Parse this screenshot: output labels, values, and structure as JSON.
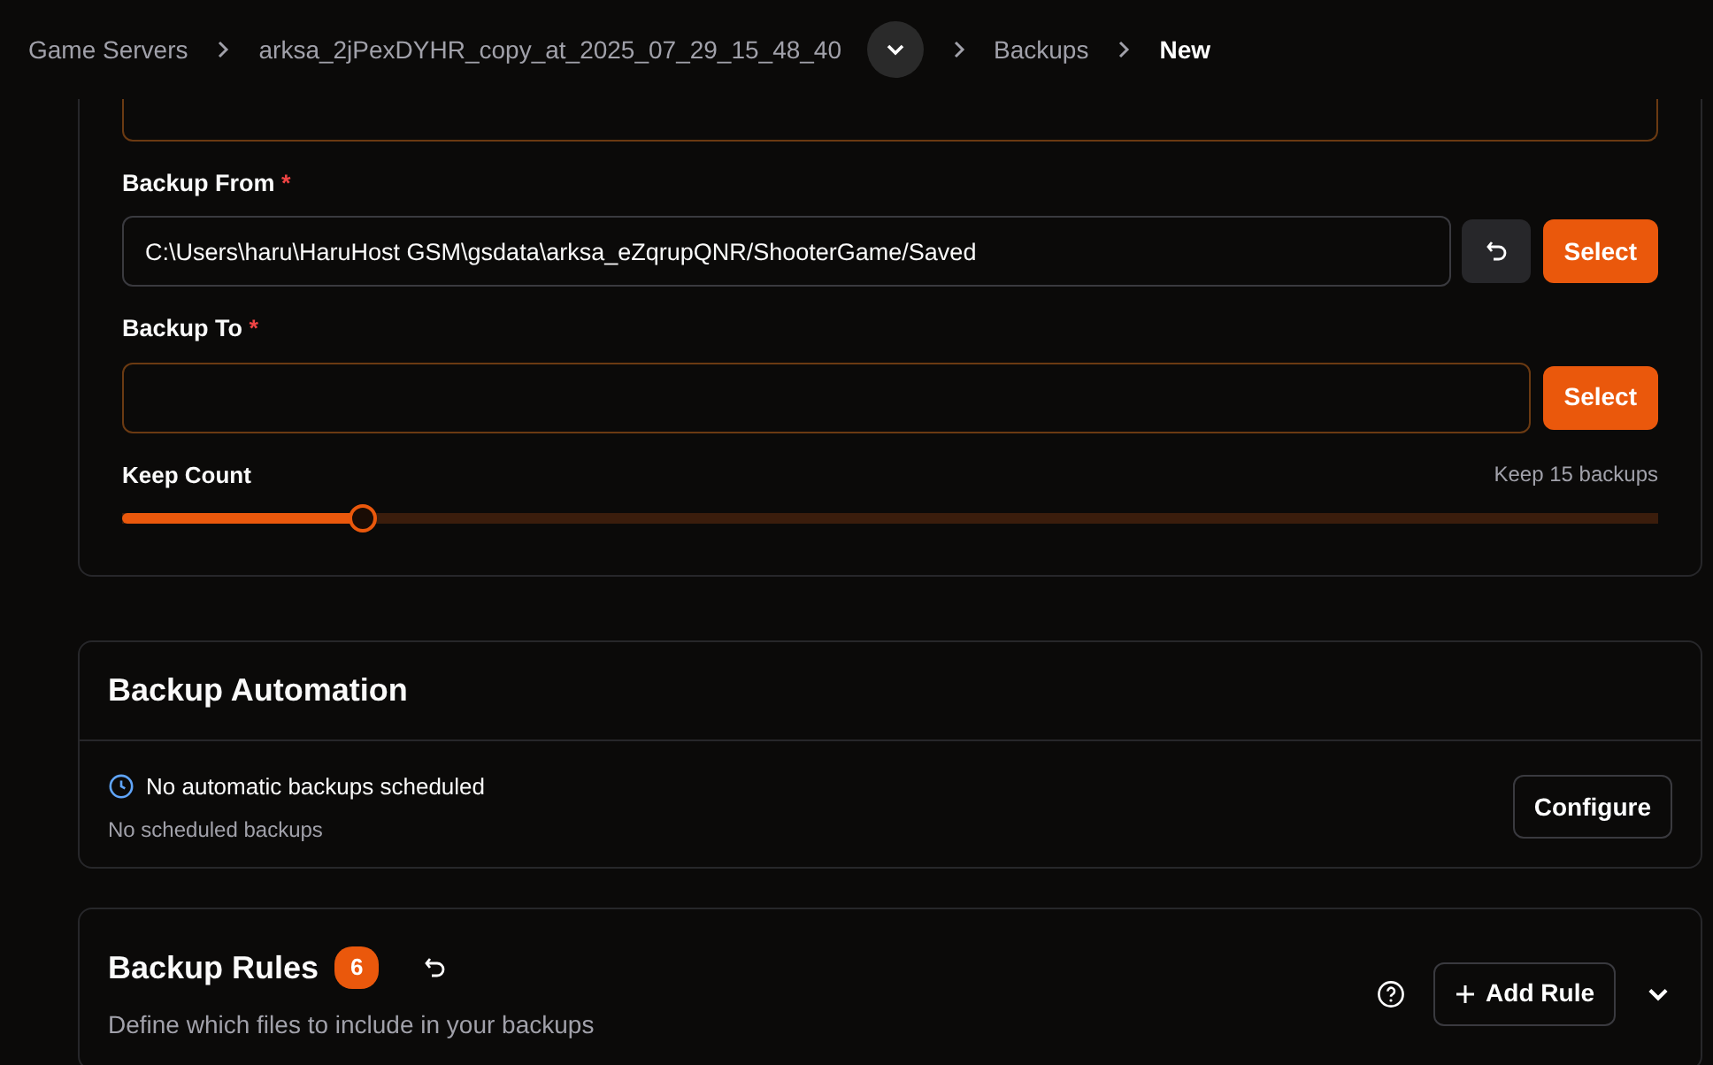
{
  "breadcrumb": [
    {
      "label": "Game Servers",
      "current": false,
      "dropdown": false
    },
    {
      "label": "arksa_2jPexDYHR_copy_at_2025_07_29_15_48_40",
      "current": false,
      "dropdown": true
    },
    {
      "label": "Backups",
      "current": false,
      "dropdown": false
    },
    {
      "label": "New",
      "current": true,
      "dropdown": false
    }
  ],
  "top_field": {
    "highlighted": true
  },
  "fields": [
    {
      "label": "Backup From",
      "required_mark": "*",
      "value": "C:\\Users\\haru\\HaruHost GSM\\gsdata\\arksa_eZqrupQNR/ShooterGame/Saved",
      "highlighted": false,
      "reset_button": true,
      "button": "Select"
    },
    {
      "label": "Backup To",
      "required_mark": "*",
      "highlighted": true,
      "reset_button": false,
      "button": "Select"
    }
  ],
  "keep_count": {
    "label": "Keep Count",
    "reading": "Keep 15 backups",
    "level": 0.157
  },
  "automation": {
    "title": "Backup Automation",
    "status": "No automatic backups scheduled",
    "detail": "No scheduled backups",
    "button": "Configure"
  },
  "rules": {
    "title": "Backup Rules",
    "count": "6",
    "description": "Define which files to include in your backups",
    "button": "Add Rule",
    "expanded": false
  }
}
